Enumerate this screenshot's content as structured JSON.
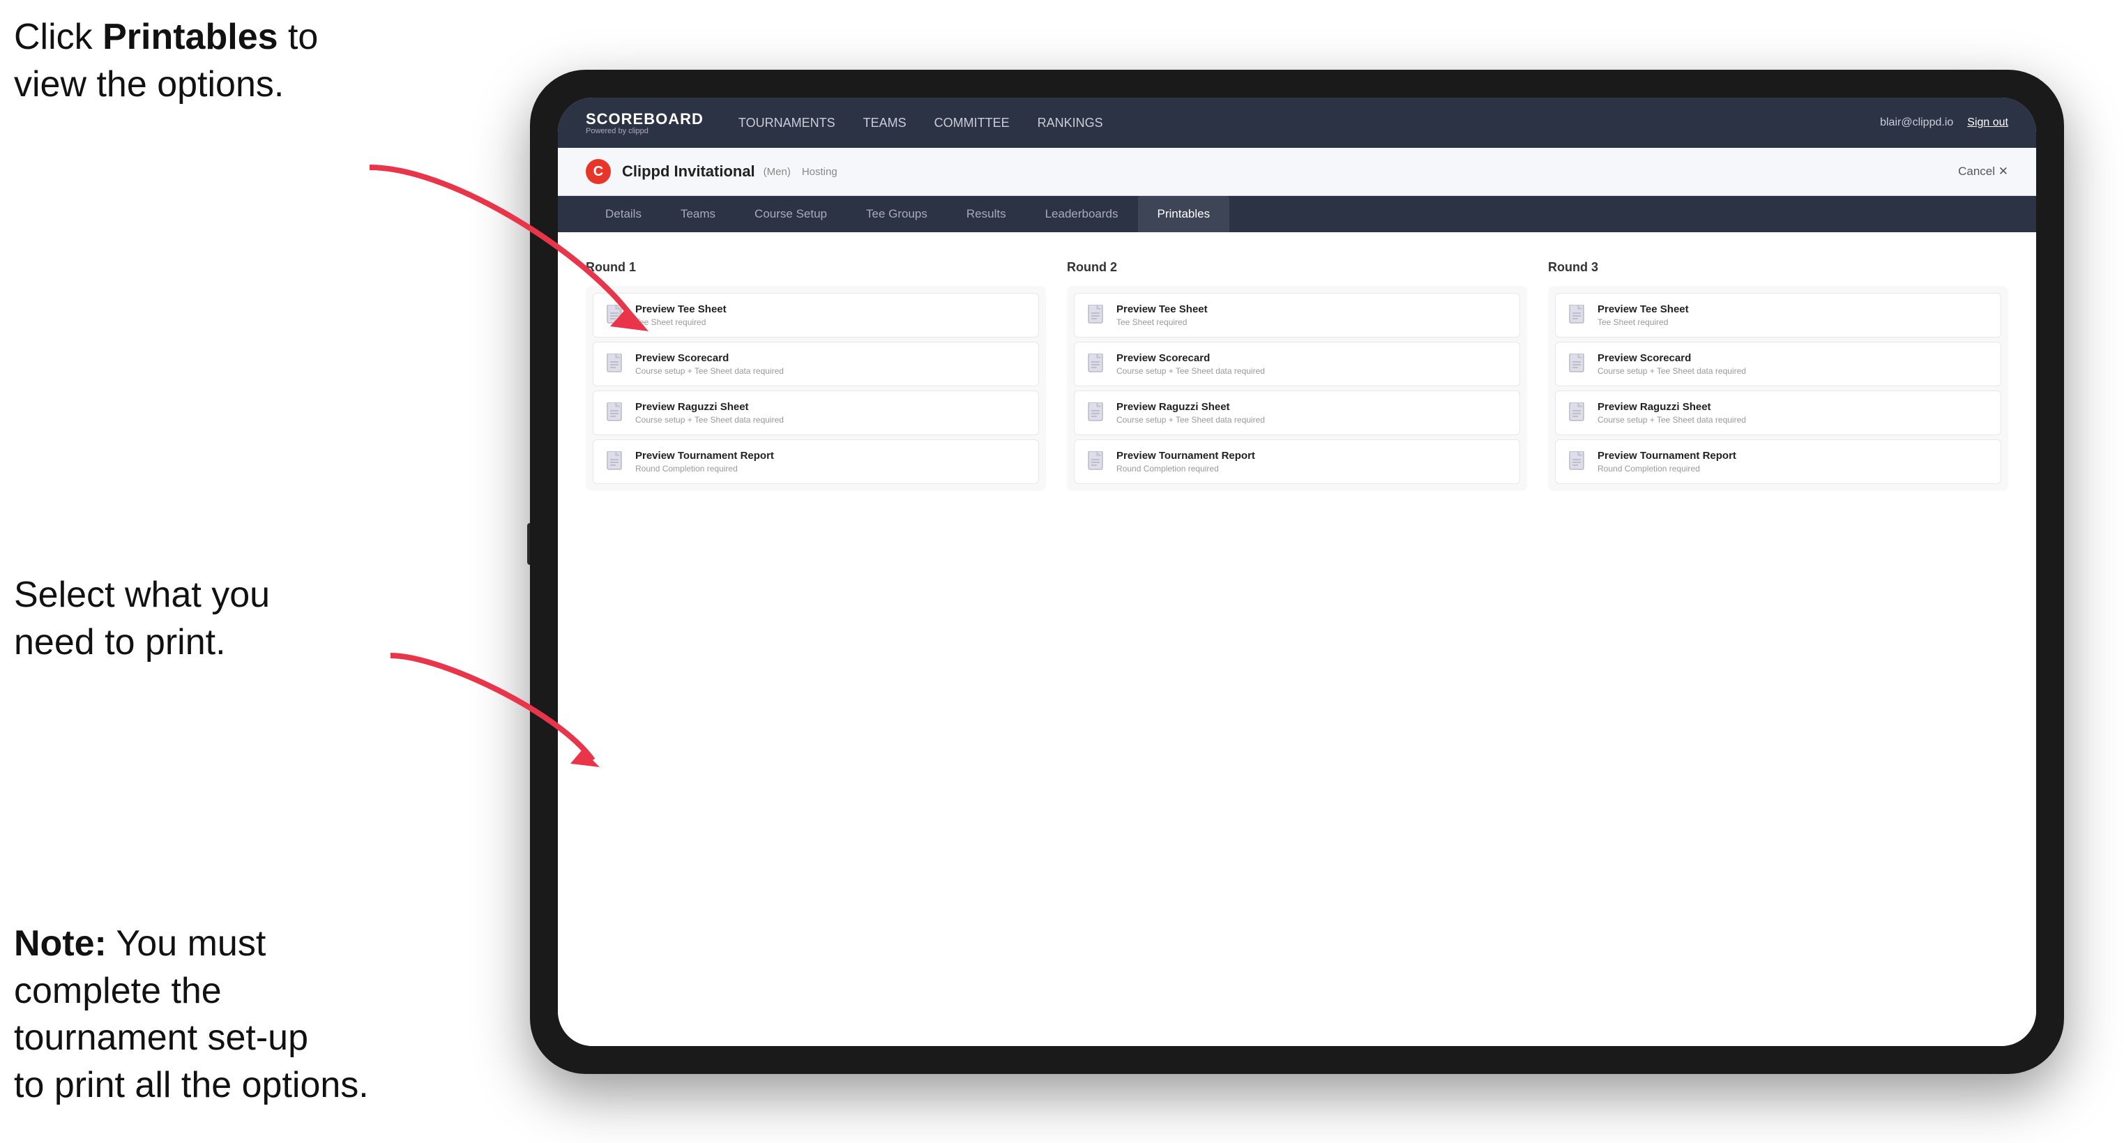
{
  "annotations": {
    "top": "Click ",
    "top_bold": "Printables",
    "top_rest": " to\nview the options.",
    "middle": "Select what you\nneed to print.",
    "bottom_bold": "Note:",
    "bottom_rest": " You must\ncomplete the\ntournament set-up\nto print all the options."
  },
  "nav": {
    "logo_title": "SCOREBOARD",
    "logo_sub": "Powered by clippd",
    "links": [
      {
        "label": "TOURNAMENTS",
        "active": false
      },
      {
        "label": "TEAMS",
        "active": false
      },
      {
        "label": "COMMITTEE",
        "active": false
      },
      {
        "label": "RANKINGS",
        "active": false
      }
    ],
    "user_email": "blair@clippd.io",
    "sign_out": "Sign out"
  },
  "tournament": {
    "logo_letter": "C",
    "name": "Clippd Invitational",
    "tag": "(Men)",
    "status": "Hosting",
    "cancel": "Cancel ✕"
  },
  "sub_tabs": [
    {
      "label": "Details",
      "active": false
    },
    {
      "label": "Teams",
      "active": false
    },
    {
      "label": "Course Setup",
      "active": false
    },
    {
      "label": "Tee Groups",
      "active": false
    },
    {
      "label": "Results",
      "active": false
    },
    {
      "label": "Leaderboards",
      "active": false
    },
    {
      "label": "Printables",
      "active": true
    }
  ],
  "rounds": [
    {
      "title": "Round 1",
      "items": [
        {
          "title": "Preview Tee Sheet",
          "sub": "Tee Sheet required"
        },
        {
          "title": "Preview Scorecard",
          "sub": "Course setup + Tee Sheet data required"
        },
        {
          "title": "Preview Raguzzi Sheet",
          "sub": "Course setup + Tee Sheet data required"
        },
        {
          "title": "Preview Tournament Report",
          "sub": "Round Completion required"
        }
      ]
    },
    {
      "title": "Round 2",
      "items": [
        {
          "title": "Preview Tee Sheet",
          "sub": "Tee Sheet required"
        },
        {
          "title": "Preview Scorecard",
          "sub": "Course setup + Tee Sheet data required"
        },
        {
          "title": "Preview Raguzzi Sheet",
          "sub": "Course setup + Tee Sheet data required"
        },
        {
          "title": "Preview Tournament Report",
          "sub": "Round Completion required"
        }
      ]
    },
    {
      "title": "Round 3",
      "items": [
        {
          "title": "Preview Tee Sheet",
          "sub": "Tee Sheet required"
        },
        {
          "title": "Preview Scorecard",
          "sub": "Course setup + Tee Sheet data required"
        },
        {
          "title": "Preview Raguzzi Sheet",
          "sub": "Course setup + Tee Sheet data required"
        },
        {
          "title": "Preview Tournament Report",
          "sub": "Round Completion required"
        }
      ]
    }
  ]
}
